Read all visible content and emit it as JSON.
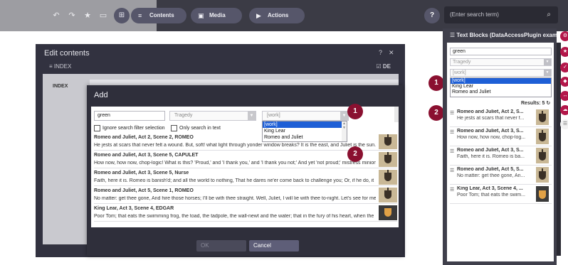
{
  "toolbar": {
    "icons": [
      "undo-icon",
      "redo-icon",
      "bookmark-icon",
      "preview-icon",
      "apps-icon"
    ],
    "contents_label": "Contents",
    "media_label": "Media",
    "actions_label": "Actions",
    "help_label": "?",
    "search_placeholder": "(Enter search term)"
  },
  "edit_contents": {
    "title": "Edit contents",
    "help": "?",
    "close": "✕",
    "index_tab": "≡ INDEX",
    "language": "☑ DE",
    "index_label": "INDEX"
  },
  "add_dialog": {
    "title": "Add",
    "search_value": "green",
    "type_select": "Tragedy",
    "work_select": "[work]",
    "dropdown_options": [
      "[work]",
      "King Lear",
      "Romeo and Juliet"
    ],
    "ignore_filter_label": "Ignore search filter selection",
    "only_text_label": "Only search in text",
    "results": [
      {
        "title": "Romeo and Juliet, Act 2, Scene 2, ROMEO",
        "text": "He jests at scars that never felt a wound. But, soft! what light through yonder window breaks? It is the east, and Juliet is the sun.",
        "thumb": "knight"
      },
      {
        "title": "Romeo and Juliet, Act 3, Scene 5, CAPULET",
        "text": "How now, how now, chop-logic! What is this? 'Proud,' and 'I thank you,' and 'I thank you not;' And yet 'not proud;' mistress minion",
        "thumb": "knight"
      },
      {
        "title": "Romeo and Juliet, Act 3, Scene 5, Nurse",
        "text": "Faith, here it is. Romeo is banish'd; and all the world to nothing, That he dares ne'er come back to challenge you; Or, if he do, it",
        "thumb": "knight"
      },
      {
        "title": "Romeo and Juliet, Act 5, Scene 1, ROMEO",
        "text": "No matter: get thee gone, And hire those horses; I'll be with thee straight. Well, Juliet, I will lie with thee to-night. Let's see for me",
        "thumb": "knight"
      },
      {
        "title": "King Lear, Act 3, Scene 4, EDGAR",
        "text": "Poor Tom; that eats the swimming frog, the toad, the tadpole, the wall-newt and the water; that in the fury of his heart, when the",
        "thumb": "crown"
      }
    ],
    "ok_label": "OK",
    "cancel_label": "Cancel"
  },
  "badges": {
    "one": "1",
    "two": "2"
  },
  "text_blocks": {
    "title": "Text Blocks (DataAccessPlugin example)",
    "search_value": "green",
    "type_select": "Tragedy",
    "work_select": "[work]",
    "dropdown_options": [
      "[work]",
      "King Lear",
      "Romeo and Juliet"
    ],
    "results_label": "Results: 5",
    "results": [
      {
        "title": "Romeo and Juliet, Act 2, S...",
        "text": "He jests at scars that never f...",
        "thumb": "knight"
      },
      {
        "title": "Romeo and Juliet, Act 3, S...",
        "text": "How now, how now, chop-log...",
        "thumb": "knight"
      },
      {
        "title": "Romeo and Juliet, Act 3, S...",
        "text": "Faith, here it is. Romeo is ba...",
        "thumb": "knight"
      },
      {
        "title": "Romeo and Juliet, Act 5, S...",
        "text": "No matter: get thee gone, An...",
        "thumb": "knight"
      },
      {
        "title": "King Lear, Act 3, Scene 4, ...",
        "text": "Poor Tom; that eats the swim...",
        "thumb": "crown"
      }
    ]
  },
  "edge_icons": [
    "cog-icon",
    "star-icon",
    "check-icon",
    "shield-icon",
    "move-icon",
    "cloud-icon",
    "text-icon"
  ],
  "colors": {
    "accent": "#8a1030",
    "edge_pink": "#b3174a",
    "selection": "#1e5fd6",
    "dark_bg": "#3b3b45"
  }
}
